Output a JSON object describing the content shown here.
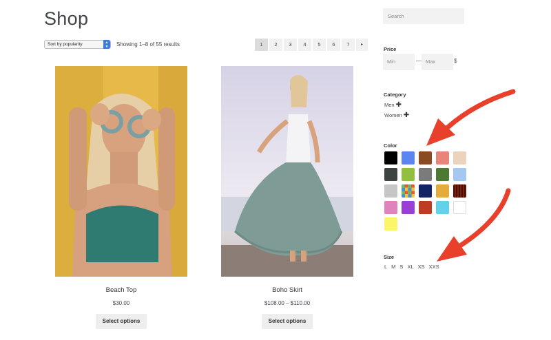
{
  "page": {
    "title": "Shop"
  },
  "toolbar": {
    "sort_label": "Sort by popularity",
    "result_count": "Showing 1–8 of 55 results"
  },
  "pagination": {
    "pages": [
      "1",
      "2",
      "3",
      "4",
      "5",
      "6",
      "7"
    ],
    "current": "1",
    "next_icon": "▸"
  },
  "products": [
    {
      "name": "Beach Top",
      "price": "$30.00",
      "button": "Select options"
    },
    {
      "name": "Boho Skirt",
      "price": "$108.00 – $110.00",
      "button": "Select options"
    }
  ],
  "sidebar": {
    "search_placeholder": "Search",
    "price": {
      "title": "Price",
      "min_placeholder": "Min",
      "max_placeholder": "Max",
      "separator": "—",
      "currency": "$"
    },
    "category": {
      "title": "Category",
      "items": [
        {
          "label": "Men"
        },
        {
          "label": "Women"
        }
      ],
      "plus": "✚"
    },
    "color": {
      "title": "Color",
      "swatches": [
        "#000000",
        "#5b86f0",
        "#8a4a22",
        "#e88478",
        "#ecd4bc",
        "#3c4340",
        "#93bf3e",
        "#7b7b7b",
        "#4c7a35",
        "#a4c8f2",
        "#c6c6c6",
        "pattern-checker",
        "#132466",
        "#e5ac3c",
        "pattern-maze",
        "#e083bd",
        "#9a3fd6",
        "#bd3d22",
        "#62d2ea",
        "#ffffff",
        "#fbf56c"
      ]
    },
    "size": {
      "title": "Size",
      "items": [
        "L",
        "M",
        "S",
        "XL",
        "XS",
        "XXS"
      ]
    }
  },
  "annotations": {
    "arrow_color": "#e8402a"
  }
}
